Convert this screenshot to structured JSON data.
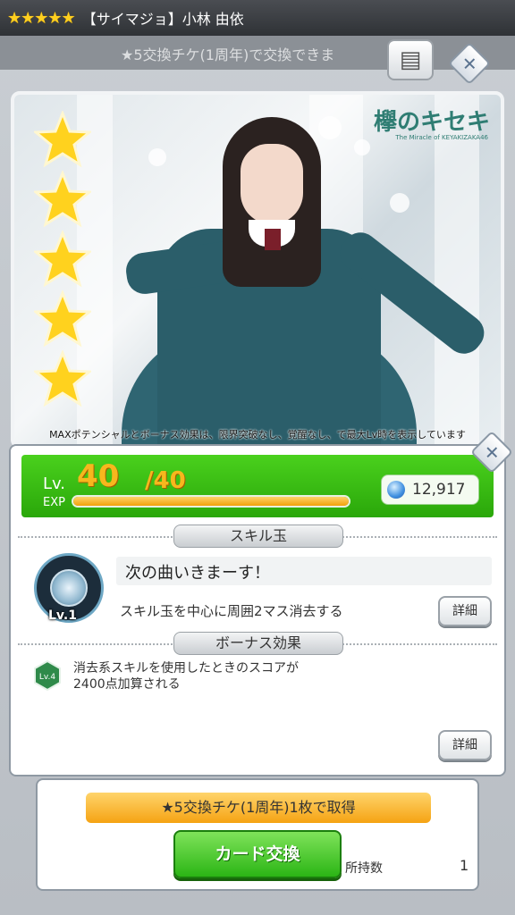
{
  "header": {
    "rarity_stars": "★★★★★",
    "card_title": "【サイマジョ】小林 由依"
  },
  "subbar": {
    "text": "★5交換チケ(1周年)で交換できま"
  },
  "buttons": {
    "memo_glyph": "▤",
    "close_glyph": "✕"
  },
  "card": {
    "rarity": 5,
    "logo": "欅のキセキ",
    "logo_sub": "The Miracle of KEYAKIZAKA46",
    "note": "MAXポテンシャルとボーナス効果は、限界突破なし、覚醒なし、で最大Lv時を表示しています"
  },
  "level": {
    "lv_label": "Lv.",
    "current": "40",
    "max": "/40",
    "exp_label": "EXP",
    "exp_fraction": 1.0,
    "gems": "12,917"
  },
  "skill": {
    "section_title": "スキル玉",
    "level_label": "Lv.1",
    "name": "次の曲いきまーす！",
    "description": "スキル玉を中心に周囲2マス消去する",
    "detail_label": "詳細"
  },
  "bonus": {
    "section_title": "ボーナス効果",
    "level_label": "Lv.4",
    "text_line1": "消去系スキルを使用したときのスコアが",
    "text_line2": "2400点加算される",
    "detail_label": "詳細"
  },
  "exchange": {
    "ticket_text": "★5交換チケ(1周年)1枚で取得",
    "button_label": "カード交換",
    "owned_label": "所持数",
    "owned_count": "1"
  },
  "colors": {
    "level_bar": "#3cc014",
    "exp_fill": "#f0a20b",
    "ticket": "#f7b52a",
    "exchange_button": "#2bb515",
    "star": "#ffd21e"
  }
}
